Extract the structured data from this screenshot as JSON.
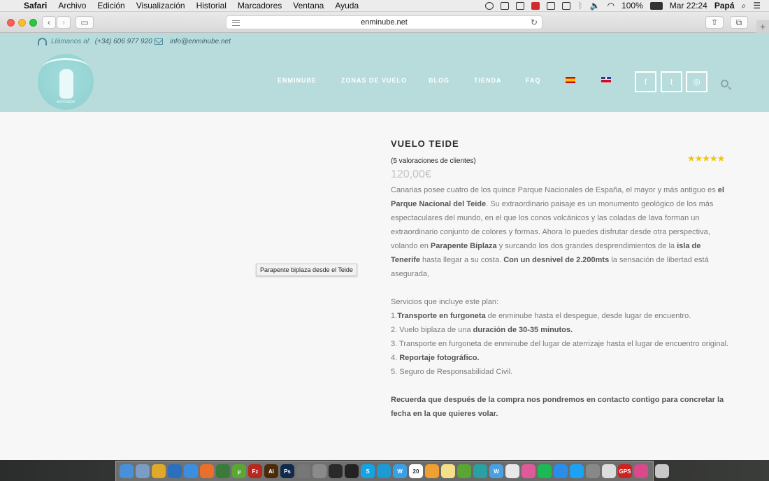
{
  "menubar": {
    "app": "Safari",
    "menus": [
      "Archivo",
      "Edición",
      "Visualización",
      "Historial",
      "Marcadores",
      "Ventana",
      "Ayuda"
    ],
    "battery": "100%",
    "clock": "Mar 22:24",
    "user": "Papá"
  },
  "browser": {
    "url": "enminube.net"
  },
  "header": {
    "phone_label": "Llámanos al:",
    "phone": "(+34) 606 977 920",
    "email": "info@enminube.net",
    "logo_text": "enminube",
    "nav": [
      "ENMINUBE",
      "ZONAS DE VUELO",
      "BLOG",
      "TIENDA",
      "FAQ"
    ],
    "social": [
      {
        "icon": "facebook-icon",
        "glyph": "f"
      },
      {
        "icon": "twitter-icon",
        "glyph": "t"
      },
      {
        "icon": "instagram-icon",
        "glyph": "◎"
      }
    ]
  },
  "image_tooltip": "Parapente biplaza desde el Teide",
  "product": {
    "title": "VUELO TEIDE",
    "rating_stars": "★★★★★",
    "rating": 5,
    "reviews": "(5 valoraciones de clientes)",
    "price": "120,00€",
    "description": {
      "p1": [
        {
          "t": "Canarias posee cuatro de los quince Parque Nacionales de España, el mayor y más antiguo es ",
          "b": false
        },
        {
          "t": "el Parque Nacional del Teide",
          "b": true
        },
        {
          "t": ". Su extraordinario paisaje es un monumento geológico de los más espectaculares del mundo, en el que los conos volcánicos y las coladas de lava forman un extraordinario conjunto de colores y formas. Ahora lo puedes disfrutar desde otra perspectiva, volando en ",
          "b": false
        },
        {
          "t": "Parapente Biplaza",
          "b": true
        },
        {
          "t": " y surcando los dos grandes desprendimientos de la ",
          "b": false
        },
        {
          "t": "isla de Tenerife",
          "b": true
        },
        {
          "t": " hasta llegar a su costa. ",
          "b": false
        },
        {
          "t": "Con un desnivel  de 2.200mts",
          "b": true
        },
        {
          "t": " la sensación de libertad está asegurada,",
          "b": false
        }
      ],
      "services_intro": "Servicios que incluye este plan:",
      "services": [
        [
          {
            "t": "1.",
            "b": false
          },
          {
            "t": "Transporte en furgoneta",
            "b": true
          },
          {
            "t": " de enminube hasta el despegue, desde lugar de encuentro.",
            "b": false
          }
        ],
        [
          {
            "t": "2. Vuelo biplaza de una ",
            "b": false
          },
          {
            "t": "duración de 30-35 minutos.",
            "b": true
          }
        ],
        [
          {
            "t": "3. Transporte en furgoneta de enminube del lugar de aterrizaje hasta el lugar de encuentro original.",
            "b": false
          }
        ],
        [
          {
            "t": "4. ",
            "b": false
          },
          {
            "t": "Reportaje fotográfico.",
            "b": true
          }
        ],
        [
          {
            "t": "5. Seguro de Responsabilidad Civil.",
            "b": false
          }
        ]
      ],
      "closing": "Recuerda que después de la compra nos pondremos en contacto contigo para concretar la fecha en la que quieres volar."
    }
  },
  "dock": [
    {
      "name": "finder",
      "color": "#4a90d9",
      "label": ""
    },
    {
      "name": "preview",
      "color": "#7b9cc4",
      "label": ""
    },
    {
      "name": "chrome",
      "color": "#e0a92a",
      "label": ""
    },
    {
      "name": "sourcetree",
      "color": "#2c6fbf",
      "label": ""
    },
    {
      "name": "safari",
      "color": "#3c8fe0",
      "label": ""
    },
    {
      "name": "firefox",
      "color": "#e8702a",
      "label": ""
    },
    {
      "name": "app-green",
      "color": "#3a7a3a",
      "label": ""
    },
    {
      "name": "utorrent",
      "color": "#5aa832",
      "label": "µ"
    },
    {
      "name": "filezilla",
      "color": "#b8281f",
      "label": "Fz"
    },
    {
      "name": "illustrator",
      "color": "#4a2a0a",
      "label": "Ai"
    },
    {
      "name": "photoshop",
      "color": "#0f2a4a",
      "label": "Ps"
    },
    {
      "name": "app-gallery",
      "color": "#777",
      "label": ""
    },
    {
      "name": "app-tools",
      "color": "#8a8a8a",
      "label": ""
    },
    {
      "name": "wifi-app",
      "color": "#2a2a2a",
      "label": ""
    },
    {
      "name": "claquette",
      "color": "#222",
      "label": ""
    },
    {
      "name": "skype",
      "color": "#12a5e6",
      "label": "S"
    },
    {
      "name": "app-blue",
      "color": "#1b9ad6",
      "label": ""
    },
    {
      "name": "app-w",
      "color": "#3aa0e6",
      "label": "W"
    },
    {
      "name": "calendar",
      "color": "#ffffff",
      "label": "20"
    },
    {
      "name": "app-orange",
      "color": "#f0a030",
      "label": ""
    },
    {
      "name": "notes",
      "color": "#f5e08a",
      "label": ""
    },
    {
      "name": "app-green2",
      "color": "#5aa632",
      "label": ""
    },
    {
      "name": "app-teal",
      "color": "#2aa0a0",
      "label": ""
    },
    {
      "name": "app-w2",
      "color": "#4aa0e0",
      "label": "W"
    },
    {
      "name": "photos",
      "color": "#e8e8e8",
      "label": ""
    },
    {
      "name": "itunes",
      "color": "#e05a9a",
      "label": ""
    },
    {
      "name": "spotify",
      "color": "#1db954",
      "label": ""
    },
    {
      "name": "app-store",
      "color": "#2a8ee8",
      "label": ""
    },
    {
      "name": "twitter",
      "color": "#1da1f2",
      "label": ""
    },
    {
      "name": "system-prefs",
      "color": "#888",
      "label": ""
    },
    {
      "name": "app-doc",
      "color": "#ddd",
      "label": ""
    },
    {
      "name": "gps-dmp",
      "color": "#c22",
      "label": "GPS"
    },
    {
      "name": "app-pink",
      "color": "#d84a8a",
      "label": ""
    },
    {
      "name": "trash",
      "color": "#c8c8c8",
      "label": ""
    }
  ]
}
